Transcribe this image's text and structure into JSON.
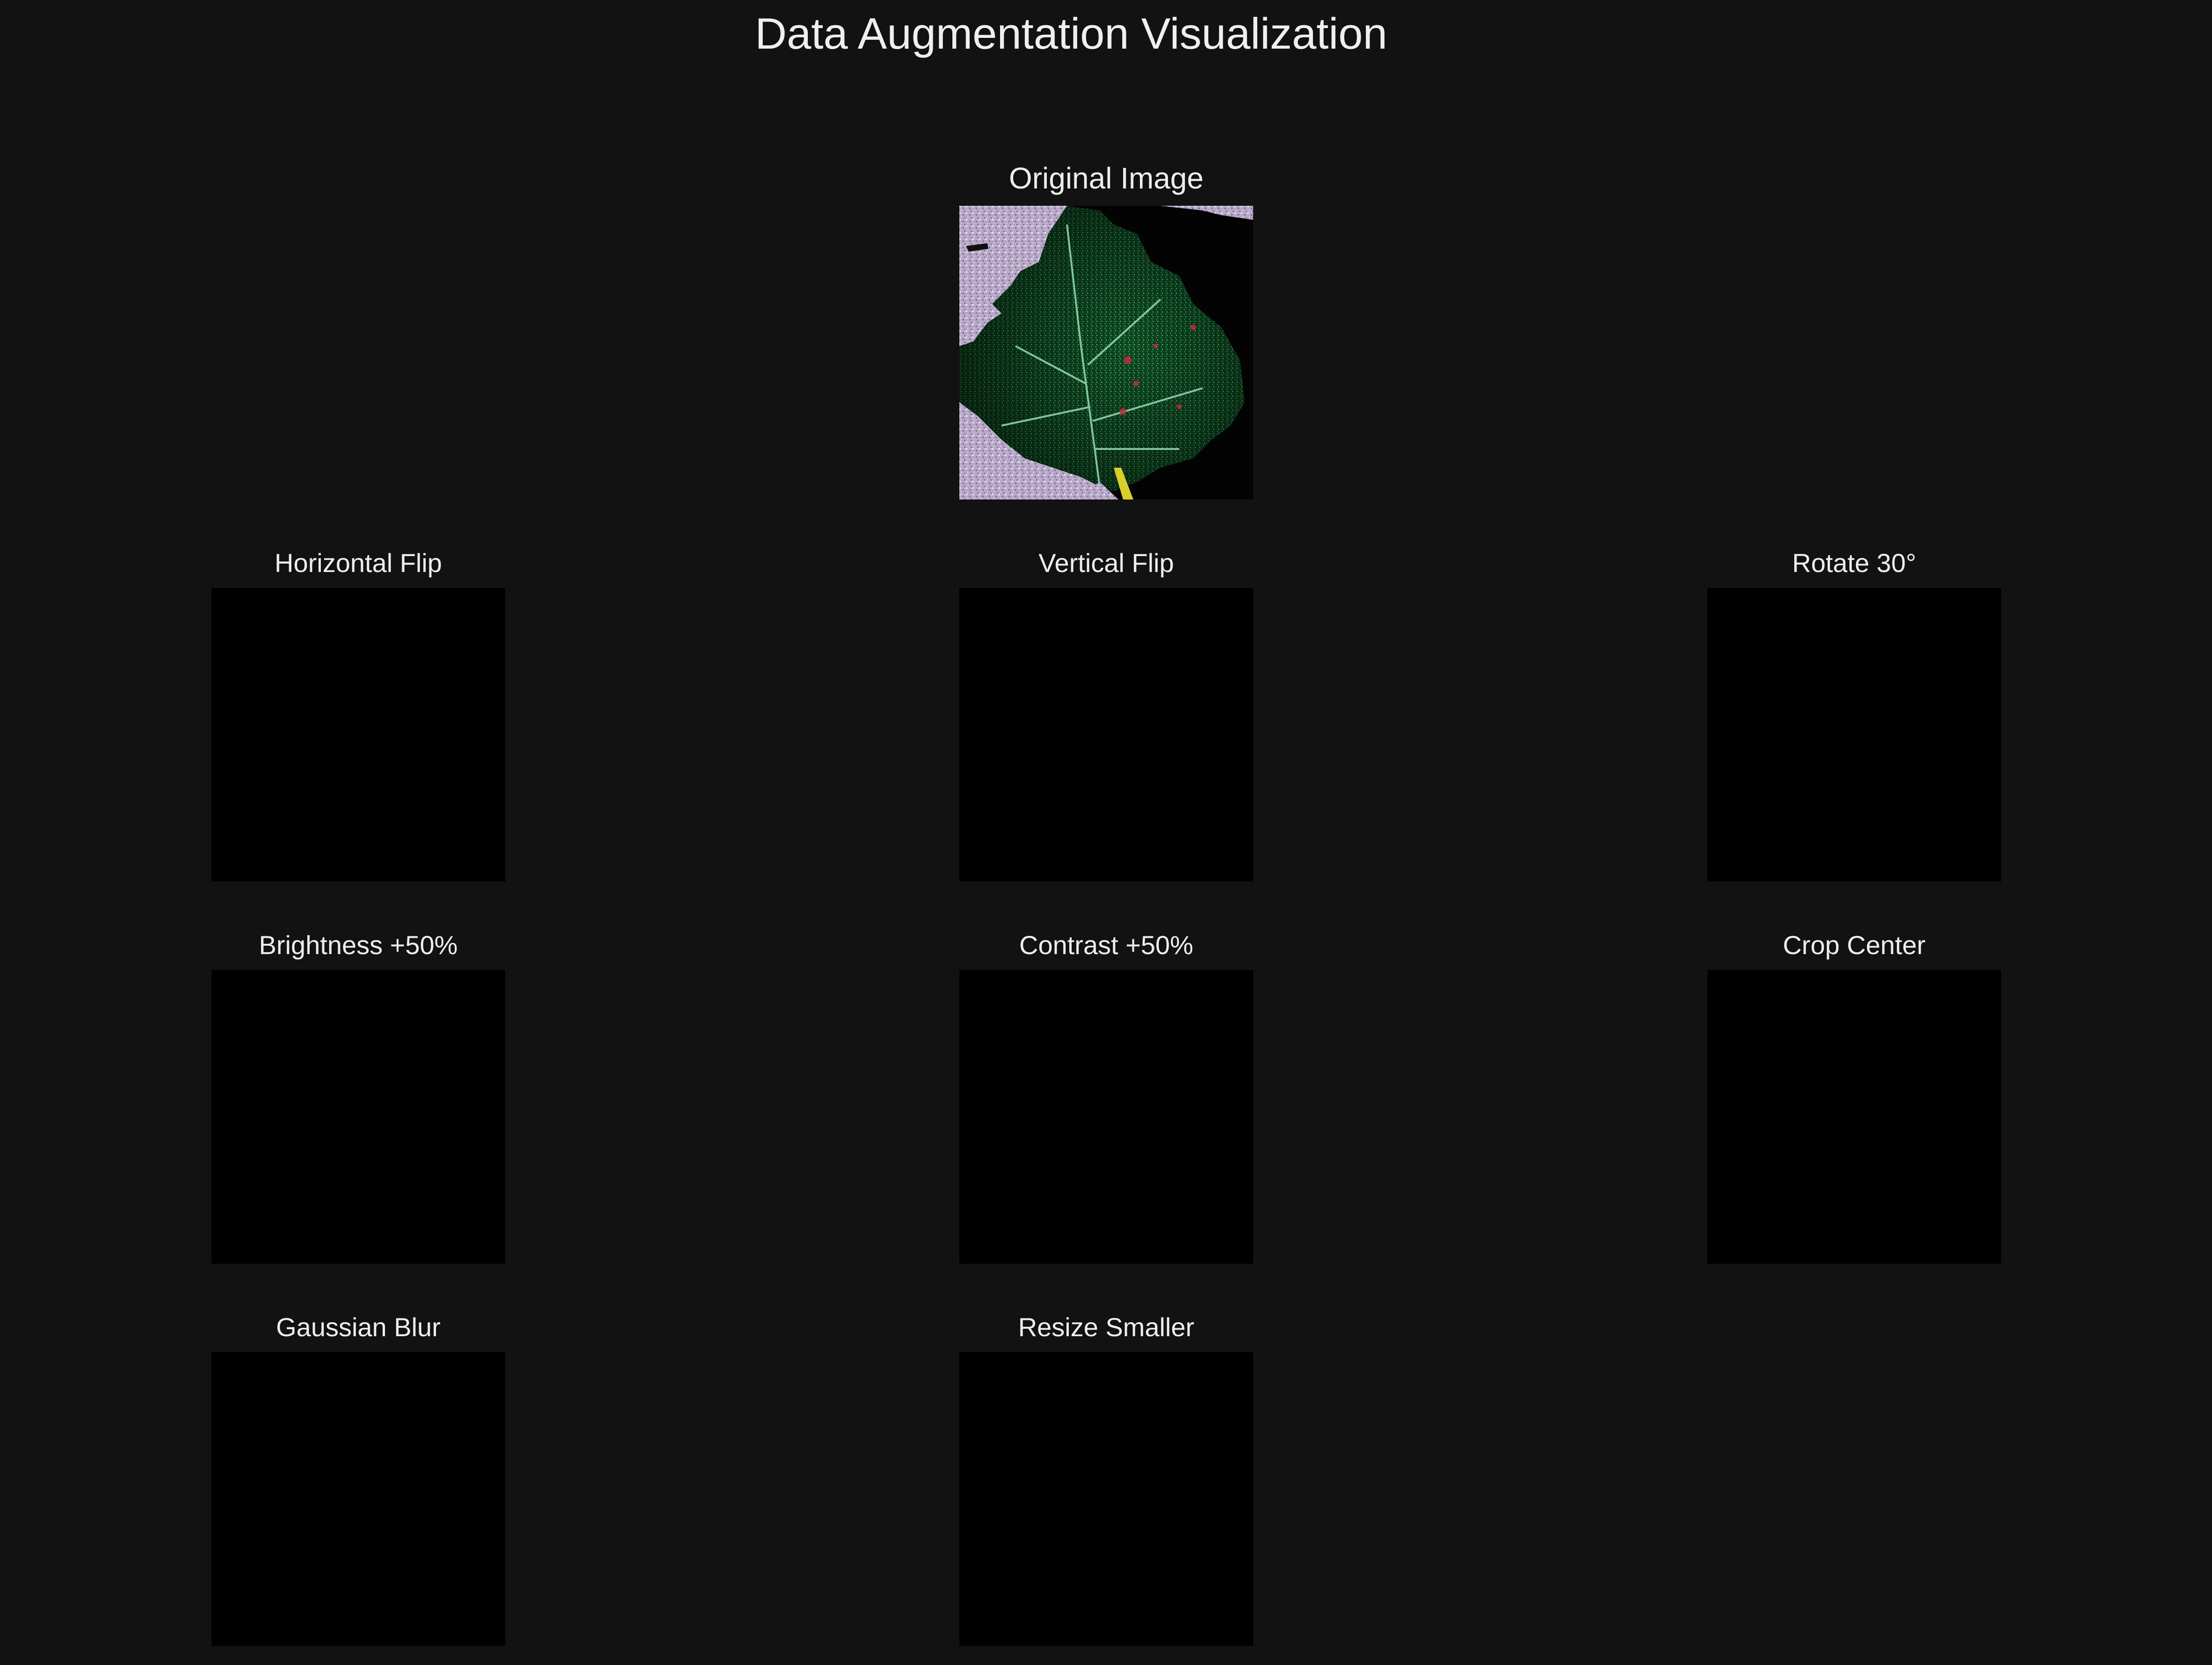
{
  "figure": {
    "title": "Data Augmentation Visualization",
    "background_color": "#121212"
  },
  "original": {
    "title": "Original Image",
    "subject": "leaf-photo"
  },
  "augmentations": [
    {
      "title": "Horizontal Flip"
    },
    {
      "title": "Vertical Flip"
    },
    {
      "title": "Rotate 30°"
    },
    {
      "title": "Brightness +50%"
    },
    {
      "title": "Contrast +50%"
    },
    {
      "title": "Crop Center"
    },
    {
      "title": "Gaussian Blur"
    },
    {
      "title": "Resize Smaller"
    }
  ]
}
